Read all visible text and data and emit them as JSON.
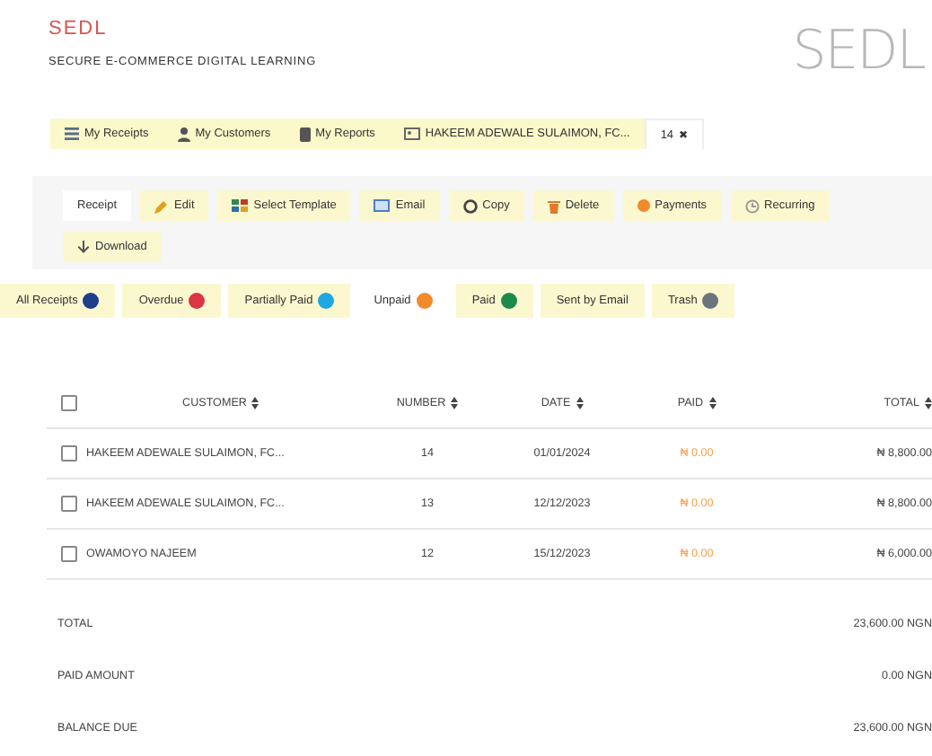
{
  "brand": {
    "name": "SEDL",
    "tagline": "SECURE E-COMMERCE DIGITAL LEARNING",
    "logo": "SEDL"
  },
  "nav_tabs": [
    {
      "label": "My Receipts",
      "selected": false
    },
    {
      "label": "My Customers",
      "selected": false
    },
    {
      "label": "My Reports",
      "selected": false
    },
    {
      "label": "HAKEEM ADEWALE SULAIMON, FC...",
      "selected": false
    },
    {
      "label": "14",
      "close": "✖",
      "selected": true
    }
  ],
  "toolbar": [
    {
      "label": "Receipt",
      "selected": true
    },
    {
      "label": "Edit",
      "selected": false
    },
    {
      "label": "Select Template",
      "selected": false
    },
    {
      "label": "Email",
      "selected": false
    },
    {
      "label": "Copy",
      "selected": false
    },
    {
      "label": "Delete",
      "selected": false
    },
    {
      "label": "Payments",
      "selected": false
    },
    {
      "label": "Recurring",
      "selected": false
    },
    {
      "label": "Download",
      "selected": false
    }
  ],
  "filters": [
    {
      "label": "All Receipts",
      "color": "#1e3f8c",
      "selected": false
    },
    {
      "label": "Overdue",
      "color": "#dc3545",
      "selected": false
    },
    {
      "label": "Partially Paid",
      "color": "#1ea7e0",
      "selected": false
    },
    {
      "label": "Unpaid",
      "color": "#f08a2c",
      "selected": true
    },
    {
      "label": "Paid",
      "color": "#1b8a4a",
      "selected": false
    },
    {
      "label": "Sent by Email",
      "selected": false
    },
    {
      "label": "Trash",
      "color": "#6c757d",
      "selected": false
    }
  ],
  "table": {
    "select_all": {
      "checked": false
    },
    "columns": [
      "CUSTOMER",
      "NUMBER",
      "DATE",
      "PAID",
      "TOTAL"
    ],
    "rows": [
      {
        "checked": false,
        "cells": [
          "HAKEEM ADEWALE SULAIMON, FC...",
          "14",
          "01/01/2024",
          "₦ 0.00",
          "₦ 8,800.00"
        ]
      },
      {
        "checked": false,
        "cells": [
          "HAKEEM ADEWALE SULAIMON, FC...",
          "13",
          "12/12/2023",
          "₦ 0.00",
          "₦ 8,800.00"
        ]
      },
      {
        "checked": false,
        "cells": [
          "OWAMOYO NAJEEM",
          "12",
          "15/12/2023",
          "₦ 0.00",
          "₦ 6,000.00"
        ]
      }
    ]
  },
  "summary": [
    {
      "label": "TOTAL",
      "value": "23,600.00 NGN"
    },
    {
      "label": "PAID AMOUNT",
      "value": "0.00 NGN"
    },
    {
      "label": "BALANCE DUE",
      "value": "23,600.00 NGN"
    }
  ]
}
